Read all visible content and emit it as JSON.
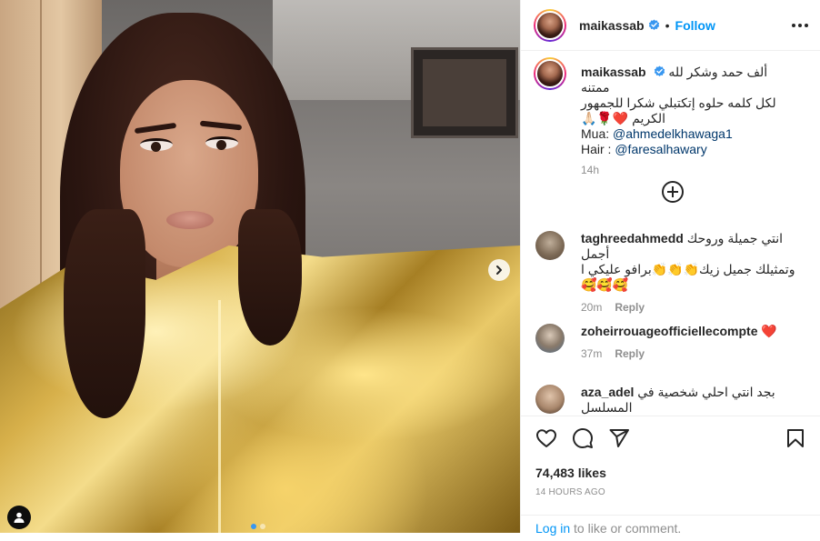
{
  "post": {
    "username": "maikassab",
    "separator": "•",
    "follow_label": "Follow",
    "icons": {
      "verified": "verified-badge-icon",
      "more": "more-options-icon",
      "next": "chevron-right-icon",
      "tag": "user-tag-icon",
      "load_more": "plus-circle-icon",
      "like": "heart-icon",
      "comment": "comment-icon",
      "share": "paper-plane-icon",
      "save": "bookmark-icon"
    },
    "colors": {
      "link": "#0095f6",
      "mention": "#00376b",
      "muted": "#8e8e8e",
      "text": "#262626",
      "carousel_active": "#3897f0"
    }
  },
  "caption": {
    "username": "maikassab",
    "text_line1": "ألف حمد وشكر لله ممتنه",
    "text_line2": "لكل كلمه حلوه إتكتبلي شكرا للجمهور",
    "text_line3": "الكريم ❤️🌹🙏🏻",
    "mua_label": "Mua: ",
    "mua_handle": "@ahmedelkhawaga1",
    "hair_label": "Hair : ",
    "hair_handle": "@faresalhawary",
    "time": "14h"
  },
  "comments": [
    {
      "username": "taghreedahmedd",
      "text_line1": "انتي جميلة وروحك أجمل",
      "text_line2": "وتمثيلك جميل زيك👏👏👏برافو عليكي ا",
      "text_line3": "🥰🥰🥰",
      "time": "20m",
      "reply": "Reply"
    },
    {
      "username": "zoheirrouageofficiellecompte",
      "text_line1": "❤️",
      "time": "37m",
      "reply": "Reply"
    },
    {
      "username": "aza_adel",
      "text_line1": "بجد انتي احلي شخصية في",
      "text_line2": "المسلسل"
    }
  ],
  "footer": {
    "likes_count": "74,483",
    "likes_suffix": " likes",
    "timestamp": "14 HOURS AGO",
    "login_link": "Log in",
    "login_rest": " to like or comment."
  }
}
